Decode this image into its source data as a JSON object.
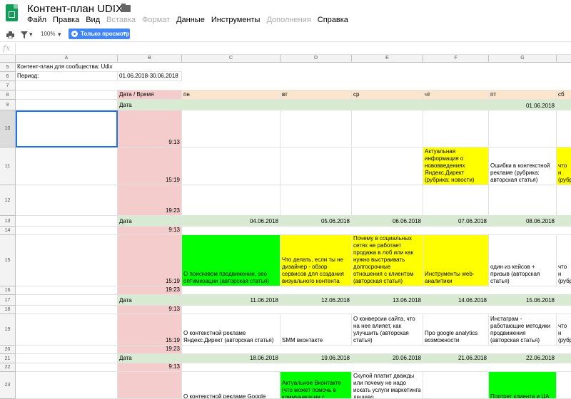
{
  "app": {
    "title": "Контент-план UDIX",
    "menu": [
      {
        "label": "Файл",
        "disabled": false
      },
      {
        "label": "Правка",
        "disabled": false
      },
      {
        "label": "Вид",
        "disabled": false
      },
      {
        "label": "Вставка",
        "disabled": true
      },
      {
        "label": "Формат",
        "disabled": true
      },
      {
        "label": "Данные",
        "disabled": false
      },
      {
        "label": "Инструменты",
        "disabled": false
      },
      {
        "label": "Дополнения",
        "disabled": true
      },
      {
        "label": "Справка",
        "disabled": false
      }
    ],
    "toolbar": {
      "zoom": "100%",
      "mode_button": "Только просмотр"
    },
    "formula_bar": {
      "fx_label": "fx",
      "value": ""
    }
  },
  "sheet": {
    "columns": [
      "A",
      "B",
      "C",
      "D",
      "E",
      "F",
      "G"
    ],
    "rows": {
      "r5": {
        "num": "5",
        "A": "Контент-план для сообщества: Udix"
      },
      "r6": {
        "num": "6",
        "A": "Период:",
        "B": "01.06.2018-30.06.2018"
      },
      "r7": {
        "num": "7"
      },
      "r8": {
        "num": "8",
        "B": "Дата / Время",
        "C": "пн",
        "D": "вт",
        "E": "ср",
        "F": "чт",
        "G": "пт",
        "H": "сб"
      },
      "r9": {
        "num": "9",
        "B": "Дата",
        "G": "01.06.2018"
      },
      "r10": {
        "num": "10",
        "B": "9:13"
      },
      "r11": {
        "num": "11",
        "B": "15:19",
        "F": "Актуальная информация о нововведениях Яндекс.Директ (рубрика: новости)",
        "G": "Ошибки в контекстной рекламе (рубрика: авторская статья)",
        "H": "что н (рубр"
      },
      "r12": {
        "num": "12",
        "B": "19:23"
      },
      "r13": {
        "num": "13",
        "B": "Дата",
        "C": "04.06.2018",
        "D": "05.06.2018",
        "E": "06.06.2018",
        "F": "07.06.2018",
        "G": "08.06.2018"
      },
      "r14": {
        "num": "14",
        "B": "9:13"
      },
      "r15": {
        "num": "15",
        "B": "15:19",
        "C": "О поисковом продвижении, seo оптимизации (авторская статья)",
        "D": "Что делать, если ты не дизайнер - обзор сервисов для создания визуального контента",
        "E": "Почему в социальных сетях не работает продажа в лоб или как нужно выстраивать долгосрочные отношения с клиентом (авторская статья)",
        "F": "Инструменты web-аналитики",
        "G": "один из кейсов + призыв (авторская статья)",
        "H": "что н (рубр"
      },
      "r16": {
        "num": "16",
        "B": "19:23"
      },
      "r17": {
        "num": "17",
        "B": "Дата",
        "C": "11.06.2018",
        "D": "12.06.2018",
        "E": "13.06.2018",
        "F": "14.06.2018",
        "G": "15.06.2018"
      },
      "r18": {
        "num": "18",
        "B": "9:13"
      },
      "r19": {
        "num": "19",
        "B": "15:19",
        "C": "О контекстной рекламе Яндекс.Директ (авторская статья)",
        "D": "SMM вконтакте",
        "E": "О конверсии сайта, что на нее влияет, как улучшить (авторская статья)",
        "F": "Про google analytics возможности",
        "G": "Инстаграм - работающие методики продвижения (авторская статья)",
        "H": "что н (рубр"
      },
      "r20": {
        "num": "20",
        "B": "19:23"
      },
      "r21": {
        "num": "21",
        "B": "Дата",
        "C": "18.06.2018",
        "D": "19.06.2018",
        "E": "20.06.2018",
        "F": "21.06.2018",
        "G": "22.06.2018"
      },
      "r22": {
        "num": "22",
        "B": "9:13"
      },
      "r23": {
        "num": "23",
        "C": "О контекстной рекламе Google",
        "D": "Актуальное Вконтакте (что может помочь в коммуникации с",
        "E": "Скупой платит дважды или почему не надо искать услуги маркетинга дешево",
        "G": "Портрет клиента и ЦА"
      }
    }
  },
  "colors": {
    "header_fill": "#fce5cd",
    "time_fill": "#f4cccc",
    "date_row_fill": "#d9ead3",
    "yellow": "#ffff00",
    "green": "#00ff00",
    "accent": "#4285f4",
    "selection": "#1a73e8"
  }
}
